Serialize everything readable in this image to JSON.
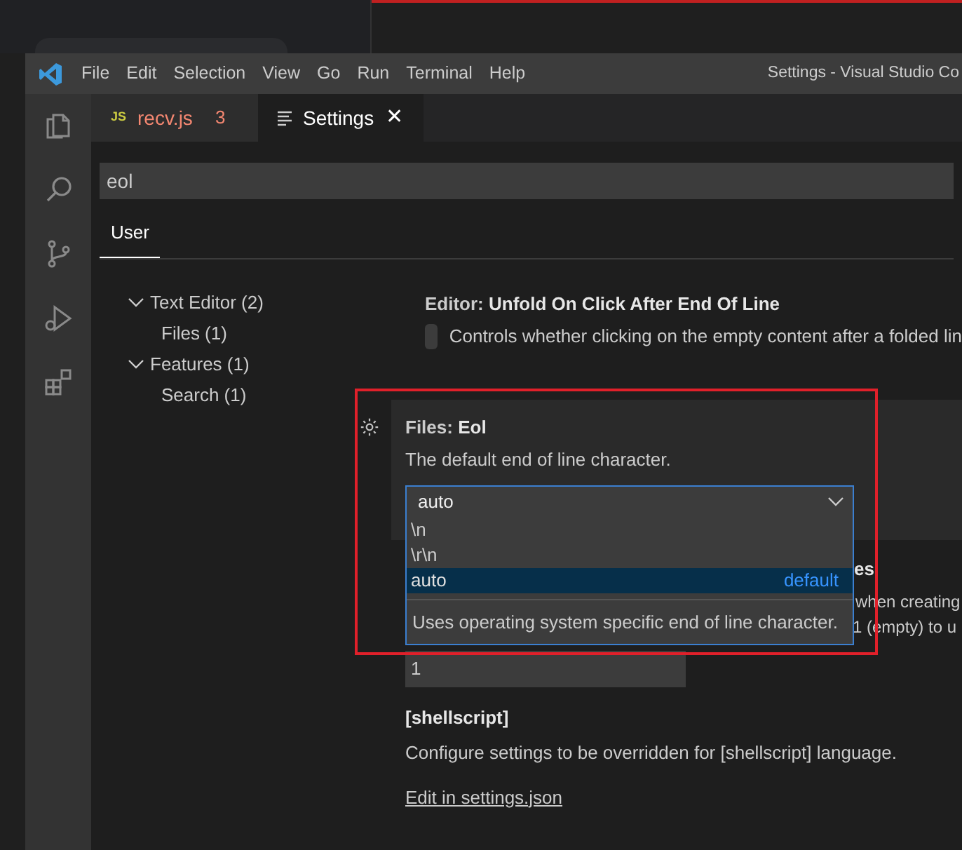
{
  "window": {
    "title": "Settings - Visual Studio Co"
  },
  "menu": [
    "File",
    "Edit",
    "Selection",
    "View",
    "Go",
    "Run",
    "Terminal",
    "Help"
  ],
  "tabs": [
    {
      "kind": "js",
      "badge": "JS",
      "label": "recv.js",
      "count": "3",
      "selected": false
    },
    {
      "kind": "settings",
      "label": "Settings",
      "selected": true,
      "close": "✕"
    }
  ],
  "search": {
    "value": "eol"
  },
  "scope_tabs": [
    {
      "label": "User",
      "selected": true
    }
  ],
  "tree": [
    {
      "label": "Text Editor (2)",
      "expanded": true,
      "children": [
        {
          "label": "Files (1)"
        }
      ]
    },
    {
      "label": "Features (1)",
      "expanded": true,
      "children": [
        {
          "label": "Search (1)"
        }
      ]
    }
  ],
  "settings": [
    {
      "kind": "checkbox",
      "category": "Editor: ",
      "title": "Unfold On Click After End Of Line",
      "description": "Controls whether clicking on the empty content after a folded lin",
      "checked": false
    },
    {
      "kind": "dropdown",
      "category": "Files: ",
      "title": "Eol",
      "description": "The default end of line character.",
      "value": "auto",
      "expanded": true,
      "options": [
        {
          "label": "\\n",
          "selected": false
        },
        {
          "label": "\\r\\n",
          "selected": false
        },
        {
          "label": "auto",
          "selected": true,
          "note": "default"
        }
      ],
      "option_description": "Uses operating system specific end of line character."
    },
    {
      "kind": "number",
      "title_fragment": "es",
      "description_fragments": [
        "when creating",
        "1 (empty) to u"
      ],
      "value": "1"
    },
    {
      "kind": "language",
      "title": "[shellscript]",
      "description": "Configure settings to be overridden for [shellscript] language.",
      "link": "Edit in settings.json"
    }
  ]
}
